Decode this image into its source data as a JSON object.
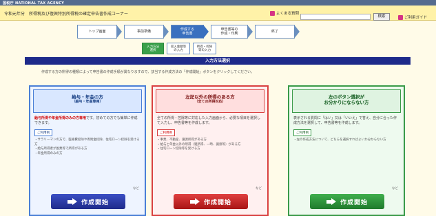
{
  "agency": {
    "logo": "国税庁 NATIONAL TAX AGENCY"
  },
  "header": {
    "title": "令和元年分　所得税及び復興特別所得税の確定申告書作成コーナー",
    "faq": "よくある質問",
    "search_button": "検索",
    "usage_guide": "ご利用ガイド"
  },
  "steps": [
    {
      "label": "トップ画面",
      "active": false
    },
    {
      "label": "事前準備",
      "active": false
    },
    {
      "label": "作成する\n申告書",
      "active": true
    },
    {
      "label": "申告書等の\n作成・印刷",
      "active": false
    },
    {
      "label": "終了",
      "active": false
    }
  ],
  "sub_steps": [
    {
      "label": "入力方法\n選択",
      "green": true
    },
    {
      "label": "収入金額等\nの入力",
      "green": false
    },
    {
      "label": "所得・控除\n等の入力",
      "green": false
    }
  ],
  "section_title": "入力方法選択",
  "instruction": "作成する方の所得の種類によって申告書の作成手順が異なりますので、該当する作成方法の「作成開始」ボタンをクリックしてください。",
  "cards": [
    {
      "title": "給与・年金の方",
      "subtitle": "（給与・年金専用）",
      "desc_highlight": "給与所得や年金所得のみの方専用",
      "desc": "です。初めての方でも簡単に作成できます。",
      "example_label": "ご利用例",
      "examples": [
        "・サラリーマンの方で、医療費控除や寄附金控除、住宅ローン控除を受ける方",
        "・給与所得者が副業等で所得がある方",
        "・年金所得のみの方"
      ],
      "etc": "など",
      "button": "作成開始"
    },
    {
      "title": "左記以外の所得のある方",
      "subtitle": "（全ての所得対応）",
      "desc_highlight": "",
      "desc": "全ての所得・控除等に対応した入力画面から、必要な項目を選択して入力し、申告書等を作成します。",
      "example_label": "ご利用例",
      "examples": [
        "・事業、不動産、譲渡所得がある方",
        "・給与と年金以外の所得（雑所得、一時、譲渡等）がある方",
        "・住宅ローン控除等を受ける方"
      ],
      "etc": "など",
      "button": "作成開始"
    },
    {
      "title": "左のボタン選択が",
      "subtitle": "お分かりにならない方",
      "desc_highlight": "",
      "desc": "表示される質問に「はい」又は「いいえ」で答え、自分に合った作成方法を選択して、申告書等を作成します。",
      "example_label": "ご利用例",
      "examples": [
        "・左の作成方法について、どちらを選択すればよいか分からない方"
      ],
      "etc": "など",
      "button": "作成開始"
    }
  ]
}
